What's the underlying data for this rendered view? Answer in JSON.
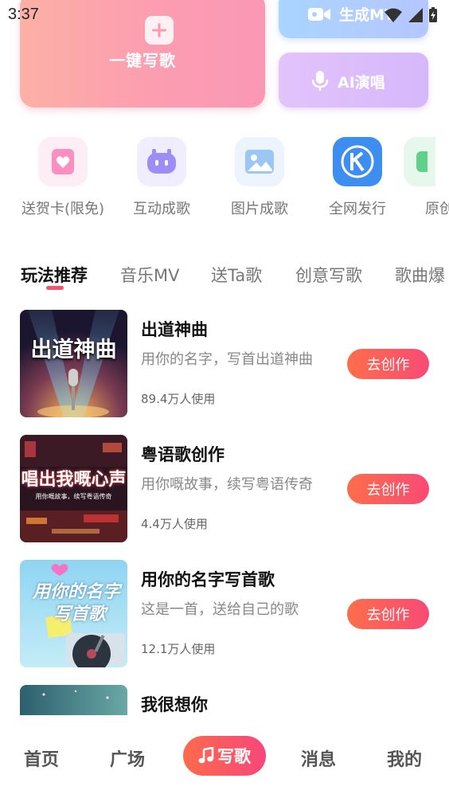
{
  "status_bar": {
    "time": "3:37"
  },
  "top_cards": {
    "big": {
      "label": "一键写歌"
    },
    "mv": {
      "label": "生成MV"
    },
    "ai": {
      "label": "AI演唱"
    }
  },
  "quick_actions": [
    {
      "label": "送贺卡(限免)",
      "icon": "heart-card-icon"
    },
    {
      "label": "互动成歌",
      "icon": "robot-icon"
    },
    {
      "label": "图片成歌",
      "icon": "image-icon"
    },
    {
      "label": "全网发行",
      "icon": "k-logo-icon"
    },
    {
      "label": "原创",
      "icon": "green-icon"
    }
  ],
  "tabs": [
    {
      "label": "玩法推荐",
      "active": true
    },
    {
      "label": "音乐MV"
    },
    {
      "label": "送Ta歌"
    },
    {
      "label": "创意写歌"
    },
    {
      "label": "歌曲爆"
    }
  ],
  "items": [
    {
      "title": "出道神曲",
      "desc": "用你的名字，写首出道神曲",
      "uses": "89.4万人使用",
      "button": "去创作",
      "thumb_text": "出道神曲"
    },
    {
      "title": "粤语歌创作",
      "desc": "用你嘅故事，续写粤语传奇",
      "uses": "4.4万人使用",
      "button": "去创作",
      "thumb_text": "唱出我嘅心声",
      "thumb_sub": "用你嘅故事，续写粤语传奇"
    },
    {
      "title": "用你的名字写首歌",
      "desc": "这是一首，送给自己的歌",
      "uses": "12.1万人使用",
      "button": "去创作",
      "thumb_text_1": "用你的名字",
      "thumb_text_2": "写首歌"
    },
    {
      "title": "我很想你"
    }
  ],
  "bottom_nav": {
    "home": "首页",
    "square": "广场",
    "write": "写歌",
    "messages": "消息",
    "mine": "我的"
  },
  "colors": {
    "accent": "#f5546e",
    "button_start": "#fd6e4a",
    "button_end": "#f84a76"
  }
}
